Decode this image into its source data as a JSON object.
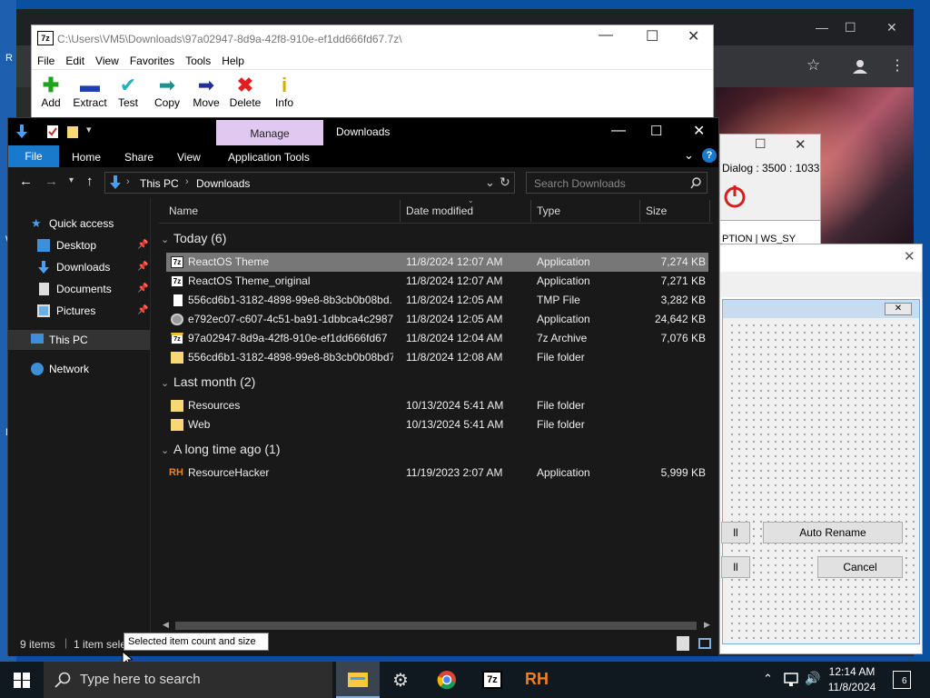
{
  "desktop": {
    "edge_letters": [
      "R",
      "W",
      "N"
    ]
  },
  "chrome_window": {
    "minimize": "—",
    "maximize": "☐",
    "close": "✕"
  },
  "sevenzip": {
    "title": "C:\\Users\\VM5\\Downloads\\97a02947-8d9a-42f8-910e-ef1dd666fd67.7z\\",
    "icon_label": "7z",
    "menu": [
      "File",
      "Edit",
      "View",
      "Favorites",
      "Tools",
      "Help"
    ],
    "tools": [
      {
        "label": "Add",
        "icon": "plus-icon",
        "color": "#1fa31f"
      },
      {
        "label": "Extract",
        "icon": "minus-icon",
        "color": "#1f3fb0"
      },
      {
        "label": "Test",
        "icon": "check-icon",
        "color": "#20b0c0"
      },
      {
        "label": "Copy",
        "icon": "right-arrow-icon",
        "color": "#1f8f8f"
      },
      {
        "label": "Move",
        "icon": "move-arrow-icon",
        "color": "#1f2f9f"
      },
      {
        "label": "Delete",
        "icon": "x-icon",
        "color": "#e02020"
      },
      {
        "label": "Info",
        "icon": "info-icon",
        "color": "#d0b000"
      }
    ]
  },
  "explorer": {
    "manage_tab": "Manage",
    "title": "Downloads",
    "ribbon": {
      "file": "File",
      "home": "Home",
      "share": "Share",
      "view": "View",
      "app_tools": "Application Tools"
    },
    "breadcrumb": {
      "root": "This PC",
      "sep": "›",
      "current": "Downloads"
    },
    "search_placeholder": "Search Downloads",
    "nav": {
      "quick_access": "Quick access",
      "desktop": "Desktop",
      "downloads": "Downloads",
      "documents": "Documents",
      "pictures": "Pictures",
      "this_pc": "This PC",
      "network": "Network"
    },
    "columns": {
      "name": "Name",
      "date": "Date modified",
      "type": "Type",
      "size": "Size"
    },
    "groups": [
      {
        "label": "Today (6)",
        "rows": [
          {
            "name": "ReactOS Theme",
            "date": "11/8/2024 12:07 AM",
            "type": "Application",
            "size": "7,274 KB",
            "icon": "app-7z-icon"
          },
          {
            "name": "ReactOS Theme_original",
            "date": "11/8/2024 12:07 AM",
            "type": "Application",
            "size": "7,271 KB",
            "icon": "app-7z-icon"
          },
          {
            "name": "556cd6b1-3182-4898-99e8-8b3cb0b08bd...",
            "date": "11/8/2024 12:05 AM",
            "type": "TMP File",
            "size": "3,282 KB",
            "icon": "file-icon"
          },
          {
            "name": "e792ec07-c607-4c51-ba91-1dbbca4c2987",
            "date": "11/8/2024 12:05 AM",
            "type": "Application",
            "size": "24,642 KB",
            "icon": "setup-icon"
          },
          {
            "name": "97a02947-8d9a-42f8-910e-ef1dd666fd67",
            "date": "11/8/2024 12:04 AM",
            "type": "7z Archive",
            "size": "7,076 KB",
            "icon": "archive-7z-icon"
          },
          {
            "name": "556cd6b1-3182-4898-99e8-8b3cb0b08bd7",
            "date": "11/8/2024 12:08 AM",
            "type": "File folder",
            "size": "",
            "icon": "folder-icon"
          }
        ]
      },
      {
        "label": "Last month (2)",
        "rows": [
          {
            "name": "Resources",
            "date": "10/13/2024 5:41 AM",
            "type": "File folder",
            "size": "",
            "icon": "folder-icon"
          },
          {
            "name": "Web",
            "date": "10/13/2024 5:41 AM",
            "type": "File folder",
            "size": "",
            "icon": "folder-icon"
          }
        ]
      },
      {
        "label": "A long time ago (1)",
        "rows": [
          {
            "name": "ResourceHacker",
            "date": "11/19/2023 2:07 AM",
            "type": "Application",
            "size": "5,999 KB",
            "icon": "rh-icon"
          }
        ]
      }
    ],
    "status": {
      "items": "9 items",
      "selected": "1 item sele"
    },
    "tooltip": "Selected item count and size"
  },
  "dialogs": {
    "dialog_caption": "Dialog : 3500 : 1033",
    "list_text": "PTION | WS_SY",
    "btn_all_top": "ll",
    "btn_all_bottom": "ll",
    "auto_rename": "Auto Rename",
    "cancel": "Cancel"
  },
  "taskbar": {
    "search_placeholder": "Type here to search",
    "time": "12:14 AM",
    "date": "11/8/2024",
    "notif_count": "6"
  }
}
